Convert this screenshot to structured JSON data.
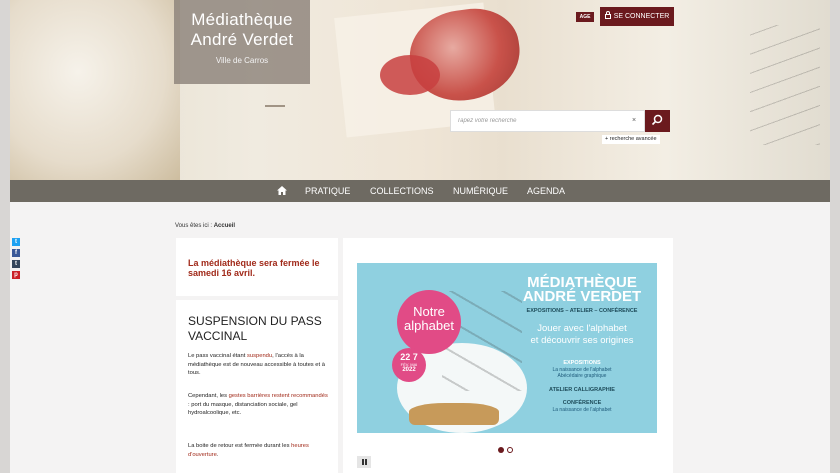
{
  "header": {
    "logo_line1": "Médiathèque",
    "logo_line2": "André Verdet",
    "logo_subtitle": "Ville de Carros",
    "age_button": "AGE",
    "connect_button": "SE CONNECTER",
    "search_placeholder": "Tapez votre recherche",
    "clear_symbol": "×",
    "advanced_search": "+ recherche avancée"
  },
  "nav": {
    "items": [
      "PRATIQUE",
      "COLLECTIONS",
      "NUMÉRIQUE",
      "AGENDA"
    ]
  },
  "share": {
    "items": [
      {
        "icon": "twitter-icon",
        "glyph": "t",
        "color": "#1da1f2"
      },
      {
        "icon": "facebook-icon",
        "glyph": "f",
        "color": "#3b5998"
      },
      {
        "icon": "tumblr-icon",
        "glyph": "t",
        "color": "#35465c"
      },
      {
        "icon": "pinterest-icon",
        "glyph": "p",
        "color": "#cb2027"
      }
    ]
  },
  "breadcrumb": {
    "prefix": "Vous êtes ici :",
    "current": "Accueil"
  },
  "notice": {
    "text": "La médiathèque sera fermée le samedi 16 avril."
  },
  "vaccin": {
    "title": "SUSPENSION DU PASS VACCINAL",
    "p1_a": "Le pass vaccinal étant ",
    "p1_hl": "suspendu",
    "p1_b": ", l'accès à la médiathèque est de nouveau accessible à toutes et à tous.",
    "p2_a": "Cependant, les ",
    "p2_hl": "gestes barrières restent recommandés",
    "p2_b": " : port du masque, distanciation sociale, gel hydroalcoolique, etc.",
    "p3_a": "La boite de retour est fermée durant les ",
    "p3_hl": "heures d'ouverture",
    "p3_b": "."
  },
  "poster": {
    "badge_line1": "Notre",
    "badge_line2": "alphabet",
    "date_days": "22 7",
    "date_months": "FÉV. MAI",
    "date_year": "2022",
    "title_line1": "MÉDIATHÈQUE",
    "title_line2": "ANDRÉ VERDET",
    "subtitle": "EXPOSITIONS – ATELIER – CONFÉRENCE",
    "tagline1": "Jouer avec l'alphabet",
    "tagline2": "et découvrir ses origines",
    "expo_title": "EXPOSITIONS",
    "expo_line1": "La naissance de l'alphabet",
    "expo_line2": "Abécédaire graphique",
    "atelier_title": "ATELIER CALLIGRAPHIE",
    "conf_title": "CONFÉRENCE",
    "conf_line": "La naissance de l'alphabet"
  },
  "slider": {
    "active_slide": 1,
    "slide_count": 2
  },
  "colors": {
    "brand": "#6b1a1e",
    "nav_bg": "#6e6a62",
    "notice_red": "#a12a1a",
    "poster_bg": "#8fd0e0",
    "badge_pink": "#e14b86"
  }
}
